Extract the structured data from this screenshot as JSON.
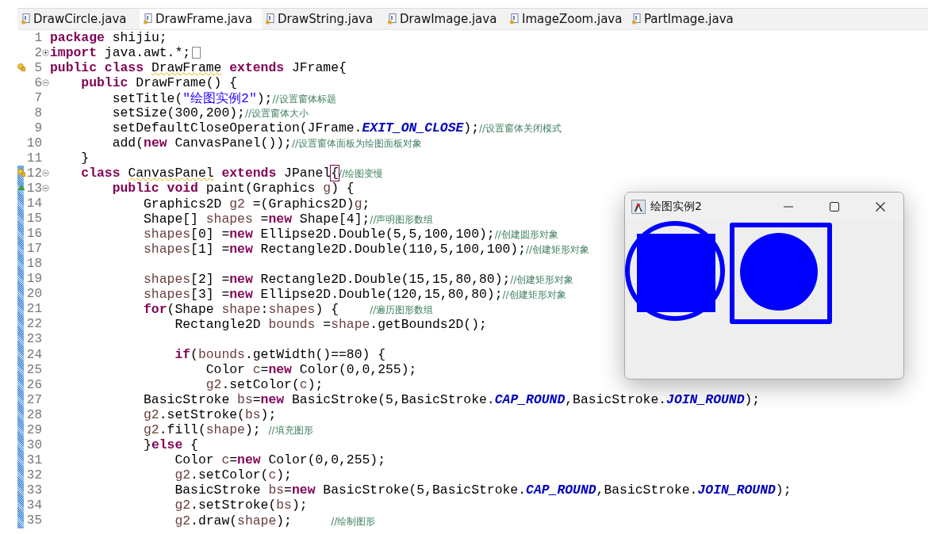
{
  "tabs": [
    {
      "label": "DrawCircle.java",
      "selected": false
    },
    {
      "label": "DrawFrame.java",
      "selected": true
    },
    {
      "label": "DrawString.java",
      "selected": false
    },
    {
      "label": "DrawImage.java",
      "selected": false
    },
    {
      "label": "ImageZoom.java",
      "selected": false
    },
    {
      "label": "PartImage.java",
      "selected": false
    }
  ],
  "editor": {
    "lines": [
      {
        "number": "1",
        "tokens": [
          {
            "kind": "keyword",
            "text": "package"
          },
          {
            "kind": "plain",
            "text": " shijiu;"
          }
        ]
      },
      {
        "number": "2",
        "collapsed": true,
        "tokens": [
          {
            "kind": "keyword",
            "text": "import"
          },
          {
            "kind": "plain",
            "text": " java.awt.*;"
          }
        ]
      },
      {
        "number": "5",
        "warning": true,
        "tokens": [
          {
            "kind": "keyword",
            "text": "public class "
          },
          {
            "kind": "warned",
            "text": "DrawFrame"
          },
          {
            "kind": "keyword",
            "text": " extends"
          },
          {
            "kind": "plain",
            "text": " JFrame{"
          }
        ]
      },
      {
        "number": "6",
        "collapsed": false,
        "tokens": [
          {
            "kind": "keyword",
            "text": "    public"
          },
          {
            "kind": "plain",
            "text": " DrawFrame() {"
          }
        ]
      },
      {
        "number": "7",
        "tokens": [
          {
            "kind": "plain",
            "text": "        setTitle("
          },
          {
            "kind": "string",
            "text": "\"绘图实例2\""
          },
          {
            "kind": "plain",
            "text": ");"
          },
          {
            "kind": "comment",
            "text": "//设置窗体标题"
          }
        ]
      },
      {
        "number": "8",
        "tokens": [
          {
            "kind": "plain",
            "text": "        setSize(300,200);"
          },
          {
            "kind": "comment",
            "text": "//设置窗体大小"
          }
        ]
      },
      {
        "number": "9",
        "tokens": [
          {
            "kind": "plain",
            "text": "        setDefaultCloseOperation(JFrame."
          },
          {
            "kind": "constant",
            "text": "EXIT_ON_CLOSE"
          },
          {
            "kind": "plain",
            "text": ");"
          },
          {
            "kind": "comment",
            "text": "//设置窗体关闭模式"
          }
        ]
      },
      {
        "number": "10",
        "tokens": [
          {
            "kind": "plain",
            "text": "        add("
          },
          {
            "kind": "keyword",
            "text": "new"
          },
          {
            "kind": "plain",
            "text": " CanvasPanel());"
          },
          {
            "kind": "comment",
            "text": "//设置窗体面板为绘图面板对象"
          }
        ]
      },
      {
        "number": "11",
        "tokens": [
          {
            "kind": "plain",
            "text": "    }"
          }
        ]
      },
      {
        "number": "12",
        "warning": true,
        "collapsed": false,
        "changed": true,
        "tokens": [
          {
            "kind": "keyword",
            "text": "    class "
          },
          {
            "kind": "warned",
            "text": "CanvasPanel"
          },
          {
            "kind": "keyword",
            "text": " extends"
          },
          {
            "kind": "plain",
            "text": " JPanel"
          },
          {
            "kind": "bracket",
            "text": "{"
          },
          {
            "kind": "comment",
            "text": "//绘图变慢"
          }
        ]
      },
      {
        "number": "13",
        "override": true,
        "collapsed": false,
        "changed": true,
        "tokens": [
          {
            "kind": "keyword",
            "text": "        public void"
          },
          {
            "kind": "plain",
            "text": " paint(Graphics "
          },
          {
            "kind": "field",
            "text": "g"
          },
          {
            "kind": "plain",
            "text": ") {"
          }
        ]
      },
      {
        "number": "14",
        "changed": true,
        "tokens": [
          {
            "kind": "plain",
            "text": "            Graphics2D "
          },
          {
            "kind": "field",
            "text": "g2"
          },
          {
            "kind": "plain",
            "text": " =(Graphics2D)"
          },
          {
            "kind": "field",
            "text": "g"
          },
          {
            "kind": "plain",
            "text": ";"
          }
        ]
      },
      {
        "number": "15",
        "changed": true,
        "tokens": [
          {
            "kind": "plain",
            "text": "            Shape[] "
          },
          {
            "kind": "field",
            "text": "shapes"
          },
          {
            "kind": "plain",
            "text": " ="
          },
          {
            "kind": "keyword",
            "text": "new"
          },
          {
            "kind": "plain",
            "text": " Shape[4];"
          },
          {
            "kind": "comment",
            "text": "//声明图形数组"
          }
        ]
      },
      {
        "number": "16",
        "changed": true,
        "tokens": [
          {
            "kind": "field",
            "text": "            shapes"
          },
          {
            "kind": "plain",
            "text": "[0] ="
          },
          {
            "kind": "keyword",
            "text": "new"
          },
          {
            "kind": "plain",
            "text": " Ellipse2D.Double(5,5,100,100);"
          },
          {
            "kind": "comment",
            "text": "//创建圆形对象"
          }
        ]
      },
      {
        "number": "17",
        "changed": true,
        "tokens": [
          {
            "kind": "field",
            "text": "            shapes"
          },
          {
            "kind": "plain",
            "text": "[1] ="
          },
          {
            "kind": "keyword",
            "text": "new"
          },
          {
            "kind": "plain",
            "text": " Rectangle2D.Double(110,5,100,100);"
          },
          {
            "kind": "comment",
            "text": "//创建矩形对象"
          }
        ]
      },
      {
        "number": "18",
        "changed": true
      },
      {
        "number": "19",
        "changed": true,
        "tokens": [
          {
            "kind": "field",
            "text": "            shapes"
          },
          {
            "kind": "plain",
            "text": "[2] ="
          },
          {
            "kind": "keyword",
            "text": "new"
          },
          {
            "kind": "plain",
            "text": " Rectangle2D.Double(15,15,80,80);"
          },
          {
            "kind": "comment",
            "text": "//创建矩形对象"
          }
        ]
      },
      {
        "number": "20",
        "changed": true,
        "tokens": [
          {
            "kind": "field",
            "text": "            shapes"
          },
          {
            "kind": "plain",
            "text": "[3] ="
          },
          {
            "kind": "keyword",
            "text": "new"
          },
          {
            "kind": "plain",
            "text": " Ellipse2D.Double(120,15,80,80);"
          },
          {
            "kind": "comment",
            "text": "//创建矩形对象"
          }
        ]
      },
      {
        "number": "21",
        "changed": true,
        "tokens": [
          {
            "kind": "keyword",
            "text": "            for"
          },
          {
            "kind": "plain",
            "text": "(Shape "
          },
          {
            "kind": "field",
            "text": "shape"
          },
          {
            "kind": "plain",
            "text": ":"
          },
          {
            "kind": "field",
            "text": "shapes"
          },
          {
            "kind": "plain",
            "text": ") {    "
          },
          {
            "kind": "comment",
            "text": "//遍历图形数组"
          }
        ]
      },
      {
        "number": "22",
        "changed": true,
        "tokens": [
          {
            "kind": "plain",
            "text": "                Rectangle2D "
          },
          {
            "kind": "field",
            "text": "bounds"
          },
          {
            "kind": "plain",
            "text": " ="
          },
          {
            "kind": "field",
            "text": "shape"
          },
          {
            "kind": "plain",
            "text": ".getBounds2D();"
          }
        ]
      },
      {
        "number": "23",
        "changed": true
      },
      {
        "number": "24",
        "changed": true,
        "tokens": [
          {
            "kind": "keyword",
            "text": "                if"
          },
          {
            "kind": "plain",
            "text": "("
          },
          {
            "kind": "field",
            "text": "bounds"
          },
          {
            "kind": "plain",
            "text": ".getWidth()==80) {"
          }
        ]
      },
      {
        "number": "25",
        "changed": true,
        "tokens": [
          {
            "kind": "plain",
            "text": "                    Color "
          },
          {
            "kind": "field",
            "text": "c"
          },
          {
            "kind": "plain",
            "text": "="
          },
          {
            "kind": "keyword",
            "text": "new"
          },
          {
            "kind": "plain",
            "text": " Color(0,0,255);"
          }
        ]
      },
      {
        "number": "26",
        "changed": true,
        "tokens": [
          {
            "kind": "field",
            "text": "                    g2"
          },
          {
            "kind": "plain",
            "text": ".setColor("
          },
          {
            "kind": "field",
            "text": "c"
          },
          {
            "kind": "plain",
            "text": ");"
          }
        ]
      },
      {
        "number": "27",
        "changed": true,
        "tokens": [
          {
            "kind": "plain",
            "text": "            BasicStroke "
          },
          {
            "kind": "field",
            "text": "bs"
          },
          {
            "kind": "plain",
            "text": "="
          },
          {
            "kind": "keyword",
            "text": "new"
          },
          {
            "kind": "plain",
            "text": " BasicStroke(5,BasicStroke."
          },
          {
            "kind": "constant",
            "text": "CAP_ROUND"
          },
          {
            "kind": "plain",
            "text": ",BasicStroke."
          },
          {
            "kind": "constant",
            "text": "JOIN_ROUND"
          },
          {
            "kind": "plain",
            "text": ");"
          }
        ]
      },
      {
        "number": "28",
        "changed": true,
        "tokens": [
          {
            "kind": "field",
            "text": "            g2"
          },
          {
            "kind": "plain",
            "text": ".setStroke("
          },
          {
            "kind": "field",
            "text": "bs"
          },
          {
            "kind": "plain",
            "text": ");"
          }
        ]
      },
      {
        "number": "29",
        "changed": true,
        "tokens": [
          {
            "kind": "field",
            "text": "            g2"
          },
          {
            "kind": "plain",
            "text": ".fill("
          },
          {
            "kind": "field",
            "text": "shape"
          },
          {
            "kind": "plain",
            "text": "); "
          },
          {
            "kind": "comment",
            "text": "//填充图形"
          }
        ]
      },
      {
        "number": "30",
        "changed": true,
        "tokens": [
          {
            "kind": "plain",
            "text": "            }"
          },
          {
            "kind": "keyword",
            "text": "else"
          },
          {
            "kind": "plain",
            "text": " {"
          }
        ]
      },
      {
        "number": "31",
        "changed": true,
        "tokens": [
          {
            "kind": "plain",
            "text": "                Color "
          },
          {
            "kind": "field",
            "text": "c"
          },
          {
            "kind": "plain",
            "text": "="
          },
          {
            "kind": "keyword",
            "text": "new"
          },
          {
            "kind": "plain",
            "text": " Color(0,0,255);"
          }
        ]
      },
      {
        "number": "32",
        "changed": true,
        "tokens": [
          {
            "kind": "field",
            "text": "                g2"
          },
          {
            "kind": "plain",
            "text": ".setColor("
          },
          {
            "kind": "field",
            "text": "c"
          },
          {
            "kind": "plain",
            "text": ");"
          }
        ]
      },
      {
        "number": "33",
        "changed": true,
        "tokens": [
          {
            "kind": "plain",
            "text": "                BasicStroke "
          },
          {
            "kind": "field",
            "text": "bs"
          },
          {
            "kind": "plain",
            "text": "="
          },
          {
            "kind": "keyword",
            "text": "new"
          },
          {
            "kind": "plain",
            "text": " BasicStroke(5,BasicStroke."
          },
          {
            "kind": "constant",
            "text": "CAP_ROUND"
          },
          {
            "kind": "plain",
            "text": ",BasicStroke."
          },
          {
            "kind": "constant",
            "text": "JOIN_ROUND"
          },
          {
            "kind": "plain",
            "text": ");"
          }
        ]
      },
      {
        "number": "34",
        "changed": true,
        "tokens": [
          {
            "kind": "field",
            "text": "                g2"
          },
          {
            "kind": "plain",
            "text": ".setStroke("
          },
          {
            "kind": "field",
            "text": "bs"
          },
          {
            "kind": "plain",
            "text": ");"
          }
        ]
      },
      {
        "number": "35",
        "changed": true,
        "tokens": [
          {
            "kind": "field",
            "text": "                g2"
          },
          {
            "kind": "plain",
            "text": ".draw("
          },
          {
            "kind": "field",
            "text": "shape"
          },
          {
            "kind": "plain",
            "text": ");     "
          },
          {
            "kind": "comment",
            "text": "//绘制图形"
          }
        ]
      }
    ]
  },
  "window": {
    "title": "绘图实例2"
  }
}
